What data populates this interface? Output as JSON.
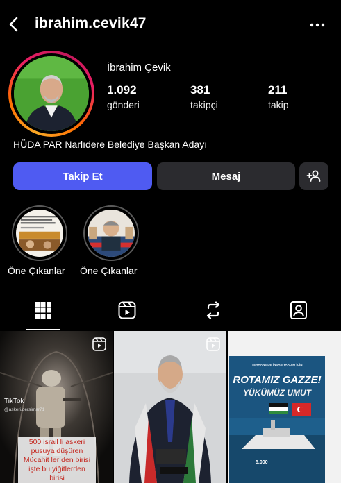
{
  "header": {
    "username": "ibrahim.cevik47"
  },
  "profile": {
    "display_name": "İbrahim Çevik",
    "stats": [
      {
        "value": "1.092",
        "label": "gönderi"
      },
      {
        "value": "381",
        "label": "takipçi"
      },
      {
        "value": "211",
        "label": "takip"
      }
    ],
    "bio": "HÜDA PAR Narlıdere Belediye Başkan Adayı"
  },
  "actions": {
    "follow": "Takip Et",
    "message": "Mesaj"
  },
  "highlights": [
    {
      "label": "Öne Çıkanlar"
    },
    {
      "label": "Öne Çıkanlar"
    }
  ],
  "tabs": [
    "grid-icon",
    "reels-icon",
    "repost-icon",
    "tagged-icon"
  ],
  "posts": {
    "post1": {
      "tiktok_label": "TikTok",
      "tiktok_user": "@askeri.dersimar71",
      "caption": "500 israil li askeri pusuya düşüren Mücahit ler den birisi işte bu yiğitlerden birisi"
    },
    "post3": {
      "headline_small": "TERHANE'DE İNSAN YARDIM İÇİN",
      "headline_1": "ROTAMIZ GAZZE!",
      "headline_2": "YÜKÜMÜZ UMUT",
      "amount": "5.000"
    }
  },
  "colors": {
    "follow_button": "#4f5bf2",
    "secondary_button": "#2b2b2f",
    "background": "#000000"
  }
}
